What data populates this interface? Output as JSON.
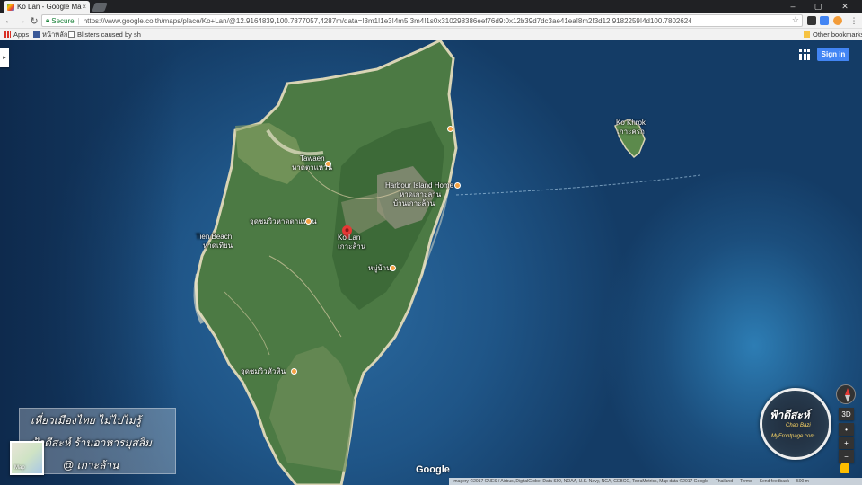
{
  "browser": {
    "tab_title": "Ko Lan - Google Maps",
    "tab_close": "×",
    "secure_label": "Secure",
    "separator": "|",
    "url": "https://www.google.co.th/maps/place/Ko+Lan/@12.9164839,100.7877057,4287m/data=!3m1!1e3!4m5!3m4!1s0x310298386eef76d9:0x12b39d7dc3ae41ea!8m2!3d12.9182259!4d100.7802624"
  },
  "bookmarks": {
    "apps": "Apps",
    "item1": "หน้าหลัก",
    "item2": "Blisters caused by sh",
    "other": "Other bookmarks"
  },
  "map": {
    "sign_in": "Sign in",
    "labels": {
      "tawaen": "Tawaen",
      "tawaen_th": "หาดตาแหวน",
      "harbour": "Harbour Island Home",
      "harbour_th1": "หาดเกาะลาน",
      "harbour_th2": "บ้านเกาะล้าน",
      "tien": "Tien Beach",
      "tien_th": "หาดเทียน",
      "viewpoint": "จุดชมวิวหาดตาแหวน",
      "kolan": "Ko Lan",
      "kolan_th": "เกาะล้าน",
      "village": "หมู่บ้าน",
      "viewpoint2": "จุดชมวิวหัวหิน",
      "kokhrok": "Ko Khrok",
      "kokhrok_th": "เกาะครก"
    },
    "minimap_label": "Map",
    "google": "Google",
    "footer": {
      "imagery": "Imagery ©2017 CNES / Airbus, DigitalGlobe, Data SIO, NOAA, U.S. Navy, NGA, GEBCO, TerraMetrics, Map data ©2017 Google",
      "country": "Thailand",
      "terms": "Terms",
      "feedback": "Send feedback",
      "scale": "500 m"
    },
    "controls": {
      "tilt": "3D",
      "zoom_in": "+",
      "zoom_out": "−"
    }
  },
  "overlay": {
    "line1": "เที่ยวเมืองไทย ไม่ไปไม่รู้",
    "line2": "ฟ้าดีสะห์ ร้านอาหารมุสลิม",
    "line3": "@ เกาะล้าน"
  },
  "logo": {
    "line1": "ฟ้าดีสะห์",
    "line2": "Chao Bazi",
    "line3": "MyFrontpage.com"
  }
}
